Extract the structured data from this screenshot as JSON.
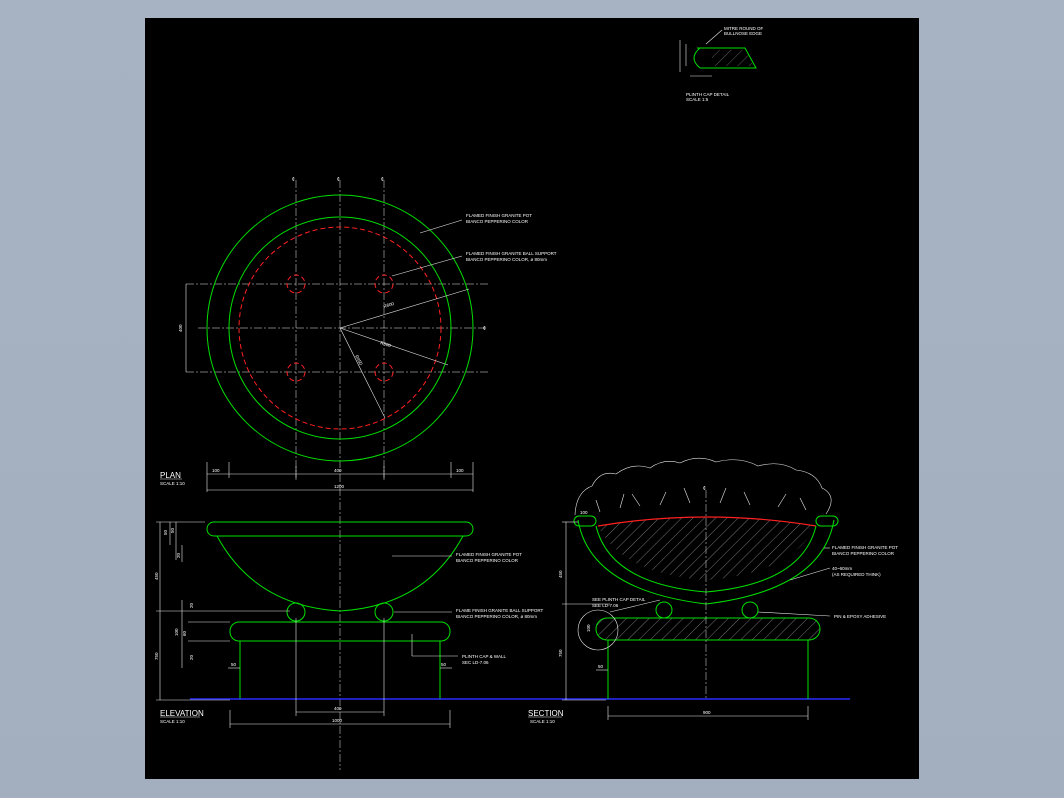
{
  "colors": {
    "outer_background": "#a7b2c2",
    "sheet_background": "#000000",
    "granite": "#00e000",
    "ball_support": "#ff2020",
    "ground_line": "#2a2aff",
    "annotation": "#ffffff"
  },
  "detail": {
    "note1": "MITRE ROUND OF",
    "note2": "BULLNOSE EDGE",
    "title": "PLINTH CAP DETAIL",
    "scale": "SCALE 1:5"
  },
  "plan": {
    "title": "PLAN",
    "scale": "SCALE 1:10",
    "note_pot_1": "FLAMED FINISH GRANITE POT",
    "note_pot_2": "BIANCO PEPPERINO COLOR",
    "note_ball_1": "FLAMED FINISH GRANITE BALL SUPPORT",
    "note_ball_2": "BIANCO PEPPERINO COLOR, ø 80mm",
    "r_600": "R600",
    "r_500": "R500",
    "r_450": "R450",
    "dim_400_v": "400",
    "dim_100_l": "100",
    "dim_400_h": "400",
    "dim_100_r": "100",
    "dim_1200": "1200",
    "center_mark": "¢"
  },
  "elevation": {
    "title": "ELEVATION",
    "scale": "SCALE 1:10",
    "note_pot_1": "FLAMED FINISH GRANITE POT",
    "note_pot_2": "BIANCO PEPPERINO COLOR",
    "note_ball_1": "FLAME FINISH GRANITE BALL SUPPORT",
    "note_ball_2": "BIANCO PEPPERINO COLOR, ø 80mm",
    "note_cap_1": "PLINTH CAP & WALL",
    "note_cap_2": "SEC LD-7.06",
    "dim_50a": "50",
    "dim_50b": "50",
    "dim_20a": "20",
    "dim_450": "450",
    "dim_20b": "20",
    "dim_100": "100",
    "dim_60": "60",
    "dim_20c": "20",
    "dim_750": "750",
    "dim_50l": "50",
    "dim_50r": "50",
    "dim_400": "400",
    "dim_1000": "1000"
  },
  "section": {
    "title": "SECTION",
    "scale": "SCALE 1:10",
    "dim_100": "100",
    "dim_450": "450",
    "dim_100b": "100",
    "dim_750": "750",
    "dim_50": "50",
    "dim_900": "900",
    "note_cap_1": "SEE PLINTH CAP DETAIL",
    "note_cap_2": "SEE LD-7.06",
    "note_pot_1": "FLAMED FINISH GRANITE POT",
    "note_pot_2": "BIANCO PEPPERINO COLOR",
    "note_thk_1": "40~60mm",
    "note_thk_2": "(AS REQUIRED THINK)",
    "note_pin": "PIN & EPOXY ADHESIVE",
    "center_mark": "¢"
  }
}
